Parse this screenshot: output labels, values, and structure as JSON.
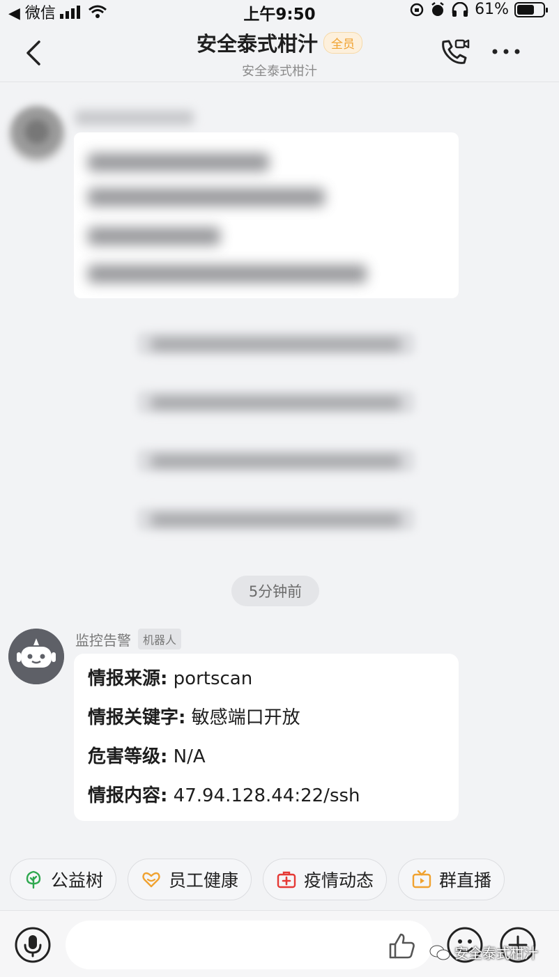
{
  "status_bar": {
    "back_app": "◀ 微信",
    "time": "上午9:50",
    "battery": "61%"
  },
  "header": {
    "title": "安全泰式柑汁",
    "badge": "全员",
    "subtitle": "安全泰式柑汁"
  },
  "timestamp": "5分钟前",
  "bot_message": {
    "sender": "监控告警",
    "tag": "机器人",
    "lines": [
      {
        "key": "情报来源:",
        "value": " portscan"
      },
      {
        "key": "情报关键字:",
        "value": " 敏感端口开放"
      },
      {
        "key": "危害等级:",
        "value": " N/A"
      },
      {
        "key": "情报内容:",
        "value": " 47.94.128.44:22/ssh"
      }
    ]
  },
  "quick_chips": [
    {
      "label": "公益树",
      "icon": "tree-icon",
      "color": "#2fa84f"
    },
    {
      "label": "员工健康",
      "icon": "heart-icon",
      "color": "#f0a230"
    },
    {
      "label": "疫情动态",
      "icon": "medical-kit-icon",
      "color": "#e53935"
    },
    {
      "label": "群直播",
      "icon": "tv-icon",
      "color": "#f0a230"
    }
  ],
  "input": {
    "placeholder": ""
  },
  "watermark": "安全泰式柑汁",
  "colors": {
    "background": "#f2f3f5",
    "bubble": "#ffffff",
    "badge_text": "#f0a230",
    "bot_avatar": "#5e6067"
  }
}
